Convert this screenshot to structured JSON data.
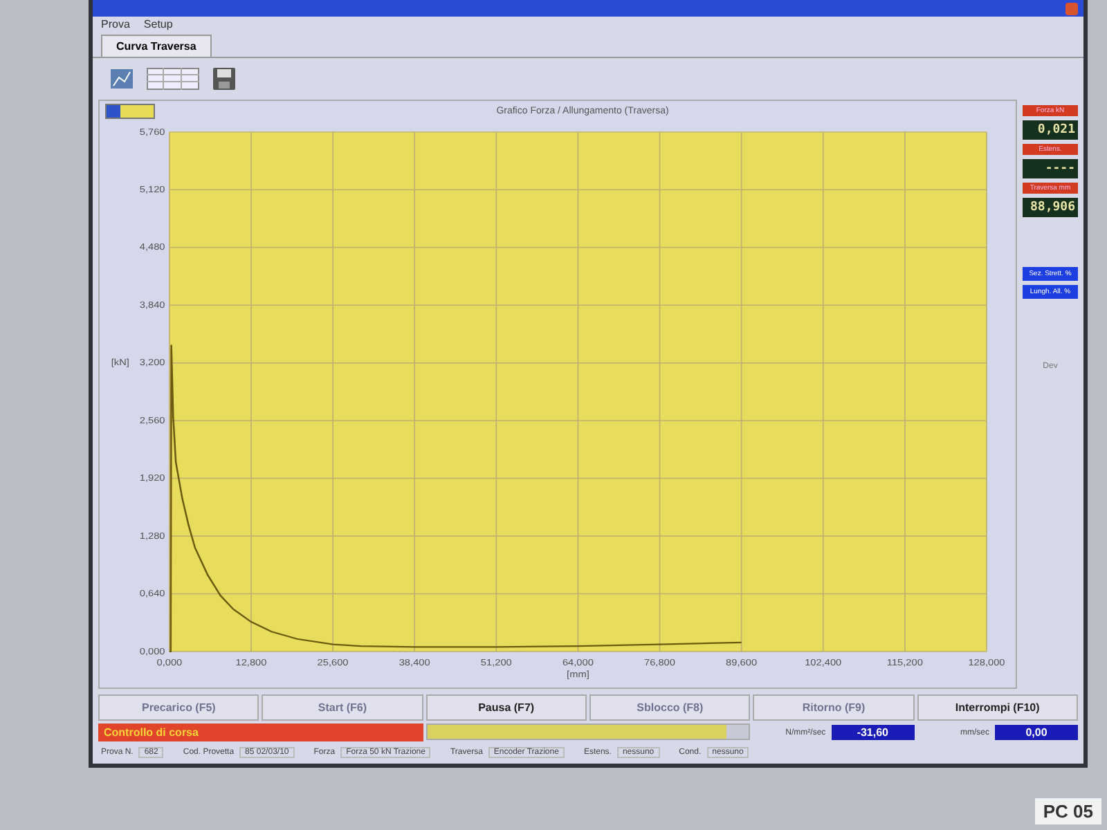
{
  "menu": [
    "Prova",
    "Setup"
  ],
  "tabs": [
    {
      "label": "Curva Traversa",
      "selected": true
    }
  ],
  "chart_panel": {
    "title": "Grafico Forza / Allungamento (Traversa)",
    "chart_data": {
      "type": "line",
      "xlabel": "[mm]",
      "ylabel": "[kN]",
      "x": [
        0,
        0.2,
        0.3,
        0.6,
        1,
        2,
        3,
        4,
        6,
        8,
        10,
        12.8,
        16,
        20,
        25.6,
        30,
        38.4,
        45,
        51.2,
        64,
        76.8,
        89.6
      ],
      "grid": true,
      "series": [
        {
          "color": "#6b5a10",
          "values": [
            0,
            0,
            3.4,
            2.6,
            2.1,
            1.7,
            1.4,
            1.15,
            0.85,
            0.62,
            0.47,
            0.33,
            0.22,
            0.14,
            0.08,
            0.06,
            0.05,
            0.05,
            0.05,
            0.06,
            0.08,
            0.1
          ]
        }
      ],
      "xlim": [
        0,
        128
      ],
      "ylim": [
        0,
        5.76
      ],
      "xticks": [
        {
          "value": 0,
          "label": "0,000"
        },
        {
          "value": 12.8,
          "label": "12,800"
        },
        {
          "value": 25.6,
          "label": "25,600"
        },
        {
          "value": 38.4,
          "label": "38,400"
        },
        {
          "value": 51.2,
          "label": "51,200"
        },
        {
          "value": 64,
          "label": "64,000"
        },
        {
          "value": 76.8,
          "label": "76,800"
        },
        {
          "value": 89.6,
          "label": "89,600"
        },
        {
          "value": 102.4,
          "label": "102,400"
        },
        {
          "value": 115.2,
          "label": "115,200"
        },
        {
          "value": 128,
          "label": "128,000"
        }
      ],
      "yticks": [
        {
          "value": 0,
          "label": "0,000"
        },
        {
          "value": 0.64,
          "label": "0,640"
        },
        {
          "value": 1.28,
          "label": "1,280"
        },
        {
          "value": 1.92,
          "label": "1,920"
        },
        {
          "value": 2.56,
          "label": "2,560"
        },
        {
          "value": 3.2,
          "label": "3,200"
        },
        {
          "value": 3.84,
          "label": "3,840"
        },
        {
          "value": 4.48,
          "label": "4,480"
        },
        {
          "value": 5.12,
          "label": "5,120"
        },
        {
          "value": 5.76,
          "label": "5,760"
        }
      ]
    }
  },
  "readouts": [
    {
      "label": "Forza kN",
      "value": "0,021"
    },
    {
      "label": "Estens.",
      "value": "----"
    },
    {
      "label": "Traversa mm",
      "value": "88,906"
    }
  ],
  "side_buttons": [
    "Sez. Strett. %",
    "Lungh. All. %"
  ],
  "side_footer": "Dev",
  "buttons": [
    {
      "label": "Precarico (F5)",
      "disabled": true
    },
    {
      "label": "Start (F6)",
      "disabled": true
    },
    {
      "label": "Pausa (F7)",
      "disabled": false
    },
    {
      "label": "Sblocco (F8)",
      "disabled": true
    },
    {
      "label": "Ritorno (F9)",
      "disabled": true
    },
    {
      "label": "Interrompi (F10)",
      "disabled": false
    }
  ],
  "alarm": "Controllo di corsa",
  "progress": {
    "level": 0.93
  },
  "speeds": [
    {
      "unit": "N/mm²/sec",
      "value": "-31,60"
    },
    {
      "unit": "mm/sec",
      "value": "0,00"
    }
  ],
  "status": [
    {
      "label": "Prova N.",
      "value": "682"
    },
    {
      "label": "Cod. Provetta",
      "value": "85 02/03/10"
    },
    {
      "label": "Forza",
      "value": "Forza 50 kN Trazione"
    },
    {
      "label": "Traversa",
      "value": "Encoder Trazione"
    },
    {
      "label": "Estens.",
      "value": "nessuno"
    },
    {
      "label": "Cond.",
      "value": "nessuno"
    }
  ],
  "monitor_label": "PC 05"
}
